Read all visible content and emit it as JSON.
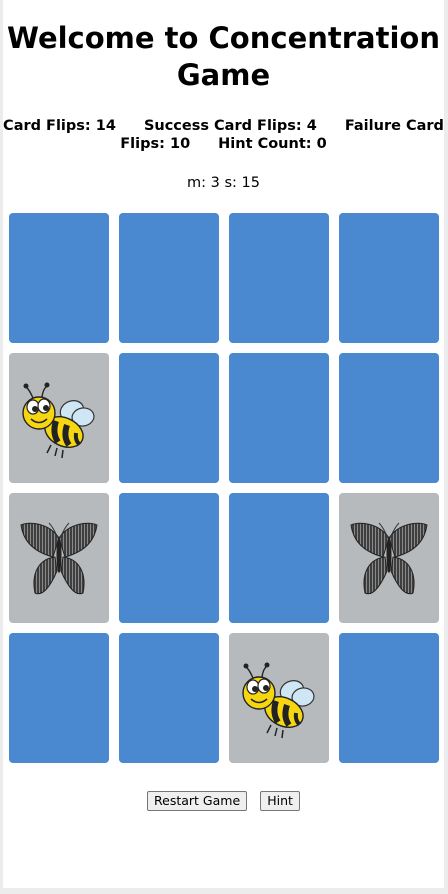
{
  "title": "Welcome to Concentration Game",
  "stats": {
    "card_flips": "Card Flips: 14",
    "success_flips": "Success Card Flips: 4",
    "failure_flips": "Failure Card Flips: 10",
    "hint_count": "Hint Count: 0"
  },
  "timer": "m: 3 s: 15",
  "colors": {
    "card_back": "#4a89d0",
    "card_face": "#b7babc"
  },
  "cards": [
    {
      "state": "down",
      "icon": ""
    },
    {
      "state": "down",
      "icon": ""
    },
    {
      "state": "down",
      "icon": ""
    },
    {
      "state": "down",
      "icon": ""
    },
    {
      "state": "up",
      "icon": "bee-icon"
    },
    {
      "state": "down",
      "icon": ""
    },
    {
      "state": "down",
      "icon": ""
    },
    {
      "state": "down",
      "icon": ""
    },
    {
      "state": "up",
      "icon": "butterfly-icon"
    },
    {
      "state": "down",
      "icon": ""
    },
    {
      "state": "down",
      "icon": ""
    },
    {
      "state": "up",
      "icon": "butterfly-icon"
    },
    {
      "state": "down",
      "icon": ""
    },
    {
      "state": "down",
      "icon": ""
    },
    {
      "state": "up",
      "icon": "bee-icon"
    },
    {
      "state": "down",
      "icon": ""
    }
  ],
  "buttons": {
    "restart": "Restart Game",
    "hint": "Hint"
  }
}
